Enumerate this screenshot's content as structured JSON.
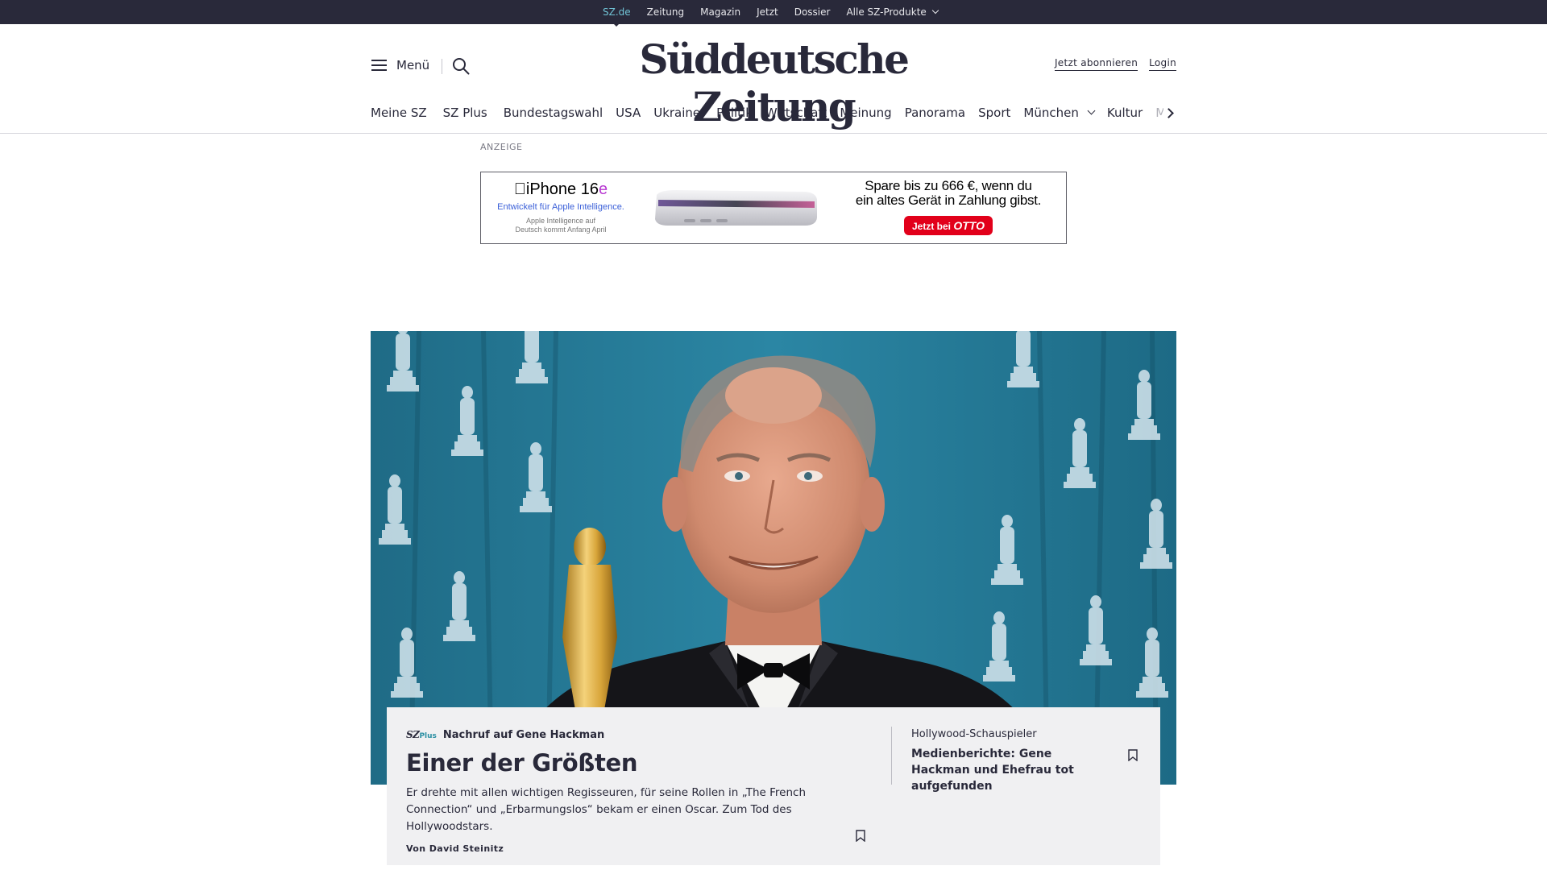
{
  "topbar": {
    "items": [
      "SZ.de",
      "Zeitung",
      "Magazin",
      "Jetzt",
      "Dossier",
      "Alle SZ-Produkte"
    ]
  },
  "header": {
    "menu_label": "Menü",
    "logo": "Süddeutsche Zeitung",
    "subscribe": "Jetzt abonnieren",
    "login": "Login"
  },
  "nav": {
    "items": [
      "Meine SZ",
      "SZ Plus",
      "Bundestagswahl",
      "USA",
      "Ukraine",
      "Politik",
      "Wirtschaft",
      "Meinung",
      "Panorama",
      "Sport",
      "München",
      "Kultur",
      "M"
    ]
  },
  "ad": {
    "label": "ANZEIGE",
    "product": "iPhone 16",
    "product_suffix": "e",
    "tagline": "Entwickelt für Apple Intelligence.",
    "note_line1": "Apple Intelligence auf",
    "note_line2": "Deutsch kommt Anfang April",
    "offer_line1": "Spare bis zu 666 €, wenn du",
    "offer_line2": "ein altes Gerät in Zahlung gibst.",
    "cta_prefix": "Jetzt bei",
    "cta_brand": "OTTO"
  },
  "teaser": {
    "badge_sz": "SZ",
    "badge_plus": "Plus",
    "kicker": "Nachruf auf Gene Hackman",
    "headline": "Einer der Größten",
    "text": "Er drehte mit allen wichtigen Regisseuren, für seine Rollen in „The French Connection“ und „Erbarmungslos“ bekam er einen Oscar.  Zum Tod des Hollywoodstars.",
    "author": "Von David Steinitz"
  },
  "side_teaser": {
    "kicker": "Hollywood-Schauspieler",
    "headline": "Medienberichte: Gene Hackman und Ehefrau tot aufgefunden"
  },
  "colors": {
    "dark": "#29293a",
    "accent": "#71c4d6",
    "teaser_bg": "#f0f0f2",
    "otto_red": "#e2001a"
  }
}
